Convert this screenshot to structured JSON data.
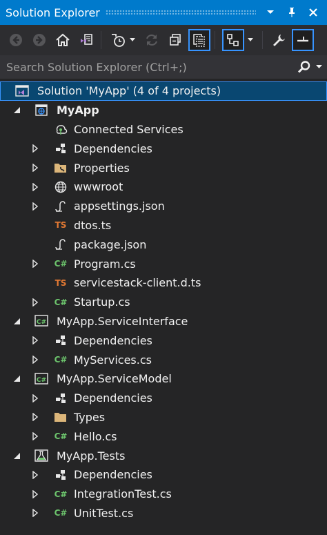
{
  "window": {
    "title": "Solution Explorer"
  },
  "search": {
    "placeholder": "Search Solution Explorer (Ctrl+;)"
  },
  "colors": {
    "accent": "#007acc",
    "selection": "#094771",
    "background": "#252526"
  },
  "tree": [
    {
      "label": "Solution 'MyApp' (4 of 4 projects)",
      "icon": "solution-icon",
      "expander": "none",
      "depth": 0,
      "selected": true,
      "bold": false
    },
    {
      "label": "MyApp",
      "icon": "web-project-icon",
      "expander": "expanded",
      "depth": 1,
      "selected": false,
      "bold": true
    },
    {
      "label": "Connected Services",
      "icon": "connected-services-icon",
      "expander": "none",
      "depth": 2,
      "selected": false,
      "bold": false
    },
    {
      "label": "Dependencies",
      "icon": "dependencies-icon",
      "expander": "collapsed",
      "depth": 2,
      "selected": false,
      "bold": false
    },
    {
      "label": "Properties",
      "icon": "properties-folder-icon",
      "expander": "collapsed",
      "depth": 2,
      "selected": false,
      "bold": false
    },
    {
      "label": "wwwroot",
      "icon": "globe-icon",
      "expander": "collapsed",
      "depth": 2,
      "selected": false,
      "bold": false
    },
    {
      "label": "appsettings.json",
      "icon": "json-file-icon",
      "expander": "collapsed",
      "depth": 2,
      "selected": false,
      "bold": false
    },
    {
      "label": "dtos.ts",
      "icon": "typescript-file-icon",
      "expander": "none",
      "depth": 2,
      "selected": false,
      "bold": false
    },
    {
      "label": "package.json",
      "icon": "json-file-icon",
      "expander": "none",
      "depth": 2,
      "selected": false,
      "bold": false
    },
    {
      "label": "Program.cs",
      "icon": "csharp-file-icon",
      "expander": "collapsed",
      "depth": 2,
      "selected": false,
      "bold": false
    },
    {
      "label": "servicestack-client.d.ts",
      "icon": "typescript-file-icon",
      "expander": "none",
      "depth": 2,
      "selected": false,
      "bold": false
    },
    {
      "label": "Startup.cs",
      "icon": "csharp-file-icon",
      "expander": "collapsed",
      "depth": 2,
      "selected": false,
      "bold": false
    },
    {
      "label": "MyApp.ServiceInterface",
      "icon": "csharp-project-icon",
      "expander": "expanded",
      "depth": 1,
      "selected": false,
      "bold": false
    },
    {
      "label": "Dependencies",
      "icon": "dependencies-icon",
      "expander": "collapsed",
      "depth": 2,
      "selected": false,
      "bold": false
    },
    {
      "label": "MyServices.cs",
      "icon": "csharp-file-icon",
      "expander": "collapsed",
      "depth": 2,
      "selected": false,
      "bold": false
    },
    {
      "label": "MyApp.ServiceModel",
      "icon": "csharp-project-icon",
      "expander": "expanded",
      "depth": 1,
      "selected": false,
      "bold": false
    },
    {
      "label": "Dependencies",
      "icon": "dependencies-icon",
      "expander": "collapsed",
      "depth": 2,
      "selected": false,
      "bold": false
    },
    {
      "label": "Types",
      "icon": "folder-icon",
      "expander": "collapsed",
      "depth": 2,
      "selected": false,
      "bold": false
    },
    {
      "label": "Hello.cs",
      "icon": "csharp-file-icon",
      "expander": "collapsed",
      "depth": 2,
      "selected": false,
      "bold": false
    },
    {
      "label": "MyApp.Tests",
      "icon": "test-project-icon",
      "expander": "expanded",
      "depth": 1,
      "selected": false,
      "bold": false
    },
    {
      "label": "Dependencies",
      "icon": "dependencies-icon",
      "expander": "collapsed",
      "depth": 2,
      "selected": false,
      "bold": false
    },
    {
      "label": "IntegrationTest.cs",
      "icon": "csharp-file-icon",
      "expander": "collapsed",
      "depth": 2,
      "selected": false,
      "bold": false
    },
    {
      "label": "UnitTest.cs",
      "icon": "csharp-file-icon",
      "expander": "collapsed",
      "depth": 2,
      "selected": false,
      "bold": false
    }
  ]
}
